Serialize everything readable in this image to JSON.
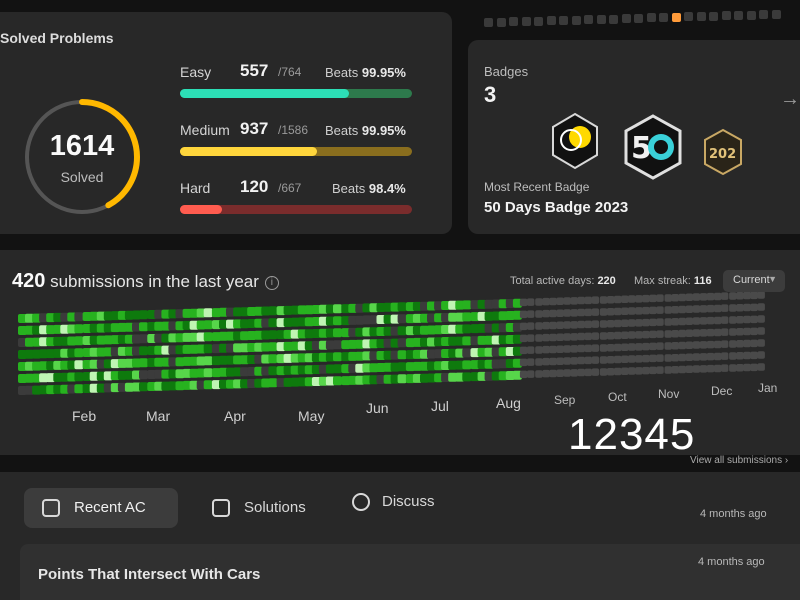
{
  "solved": {
    "title": "Solved Problems",
    "total": "1614",
    "total_label": "Solved",
    "ring_fraction": 0.42,
    "difficulties": [
      {
        "name": "Easy",
        "solved": "557",
        "total": "/764",
        "beats_label": "Beats",
        "beats_pct": "99.95%",
        "fraction": 0.73,
        "color": "#2cdfb6",
        "track": "#2d7a4c"
      },
      {
        "name": "Medium",
        "solved": "937",
        "total": "/1586",
        "beats_label": "Beats",
        "beats_pct": "99.95%",
        "fraction": 0.59,
        "color": "#ffd63c",
        "track": "#8a6e1e"
      },
      {
        "name": "Hard",
        "solved": "120",
        "total": "/667",
        "beats_label": "Beats",
        "beats_pct": "98.4%",
        "fraction": 0.18,
        "color": "#ff5c4f",
        "track": "#7a2c2c"
      }
    ]
  },
  "badges": {
    "label": "Badges",
    "count": "3",
    "recent_label": "Most Recent Badge",
    "recent_name": "50 Days Badge 2023",
    "items": [
      "days-badge-icon",
      "50-days-badge-icon",
      "2023-badge-icon"
    ]
  },
  "submissions": {
    "count": "420",
    "title_rest": " submissions in the last year",
    "active_label": "Total active days:",
    "active_value": "220",
    "streak_label": "Max streak:",
    "streak_value": "116",
    "select_value": "Current",
    "months": [
      "Feb",
      "Mar",
      "Apr",
      "May",
      "Jun",
      "Jul",
      "Aug",
      "Sep",
      "Oct",
      "Nov",
      "Dec",
      "Jan"
    ],
    "big_numbers": "12345",
    "view_all": "View all submissions"
  },
  "recent": {
    "tabs": [
      "Recent AC",
      "Solutions",
      "Discuss"
    ],
    "rows": [
      {
        "title": "",
        "time": "4 months ago"
      },
      {
        "title": "Points That Intersect With Cars",
        "time": "4 months ago"
      }
    ]
  },
  "colors": {
    "accent_ring": "#ffb800",
    "heat_levels": [
      "#3b3b3b",
      "#0e7a0d",
      "#27b21f",
      "#57d64a",
      "#bff5b3"
    ]
  }
}
